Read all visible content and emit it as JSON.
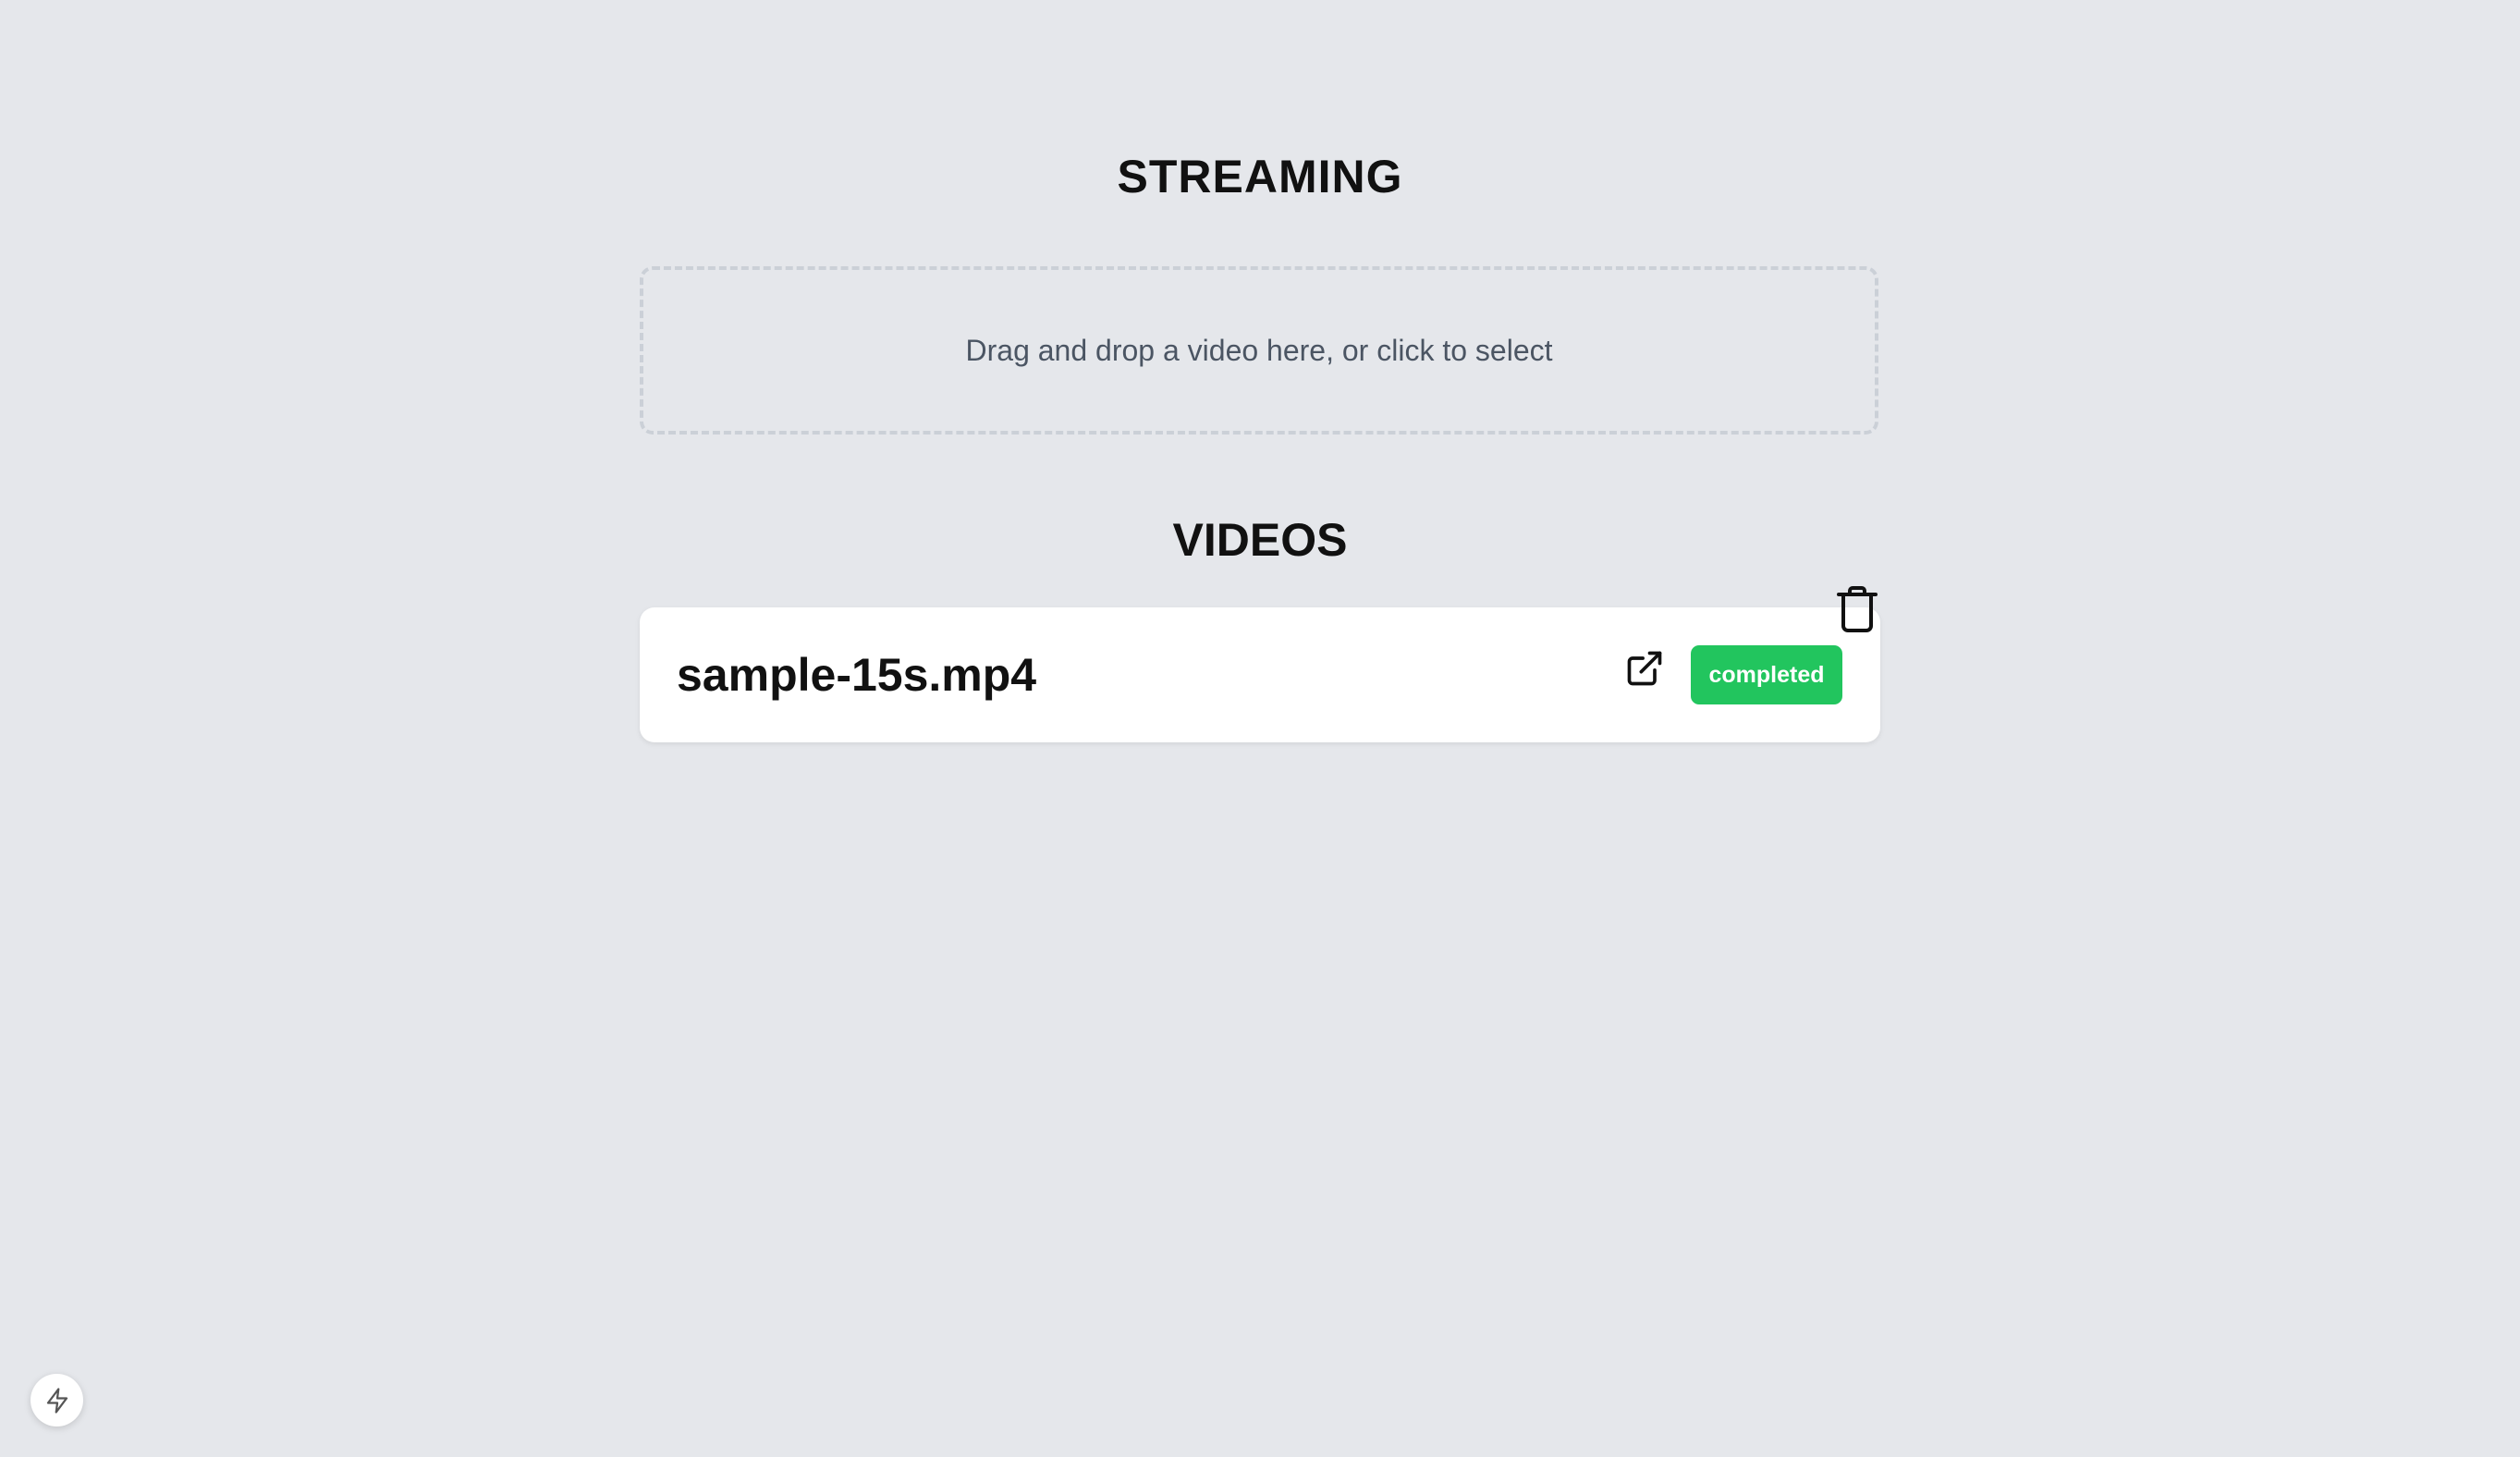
{
  "header": {
    "title": "STREAMING"
  },
  "upload": {
    "prompt": "Drag and drop a video here, or click to select"
  },
  "videos": {
    "title": "VIDEOS",
    "items": [
      {
        "name": "sample-15s.mp4",
        "status": "completed",
        "status_color": "#22c55e",
        "actions": [
          "external-link-icon",
          "trash-icon"
        ]
      }
    ]
  },
  "fab": {
    "icon": "lightning-icon"
  },
  "colors": {
    "background": "#e5e7eb",
    "card": "#ffffff",
    "text": "#111111",
    "muted_text": "#4b5563",
    "success": "#22c55e"
  }
}
